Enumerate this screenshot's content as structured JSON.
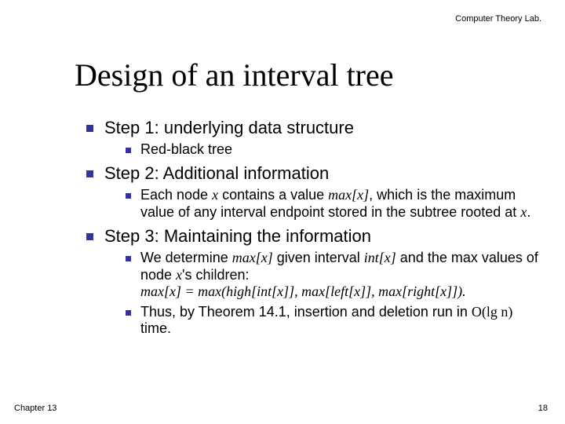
{
  "header": {
    "lab": "Computer Theory Lab."
  },
  "title": "Design of an interval tree",
  "steps": {
    "s1": {
      "head": "Step 1: underlying data structure",
      "sub1": "Red-black tree"
    },
    "s2": {
      "head": "Step 2: Additional information",
      "sub1_a": "Each node ",
      "sub1_b": " contains a value ",
      "sub1_c": ", which is the maximum value of any interval endpoint stored in the subtree rooted at ",
      "sub1_d": "."
    },
    "s3": {
      "head": "Step 3: Maintaining the information",
      "sub1_a": "We determine ",
      "sub1_b": " given interval ",
      "sub1_c": " and the max values of node ",
      "sub1_d": "'s children:",
      "eq": "max[x] = max(high[int[x]], max[left[x]], max[right[x]]).",
      "sub2_a": "Thus, by Theorem 14.1, insertion and deletion run in ",
      "sub2_b": " time."
    }
  },
  "sym": {
    "x": "x",
    "maxx": "max[x]",
    "intx": "int[x]",
    "olgn": "O(lg n)"
  },
  "footer": {
    "chapter": "Chapter 13",
    "page": "18"
  }
}
